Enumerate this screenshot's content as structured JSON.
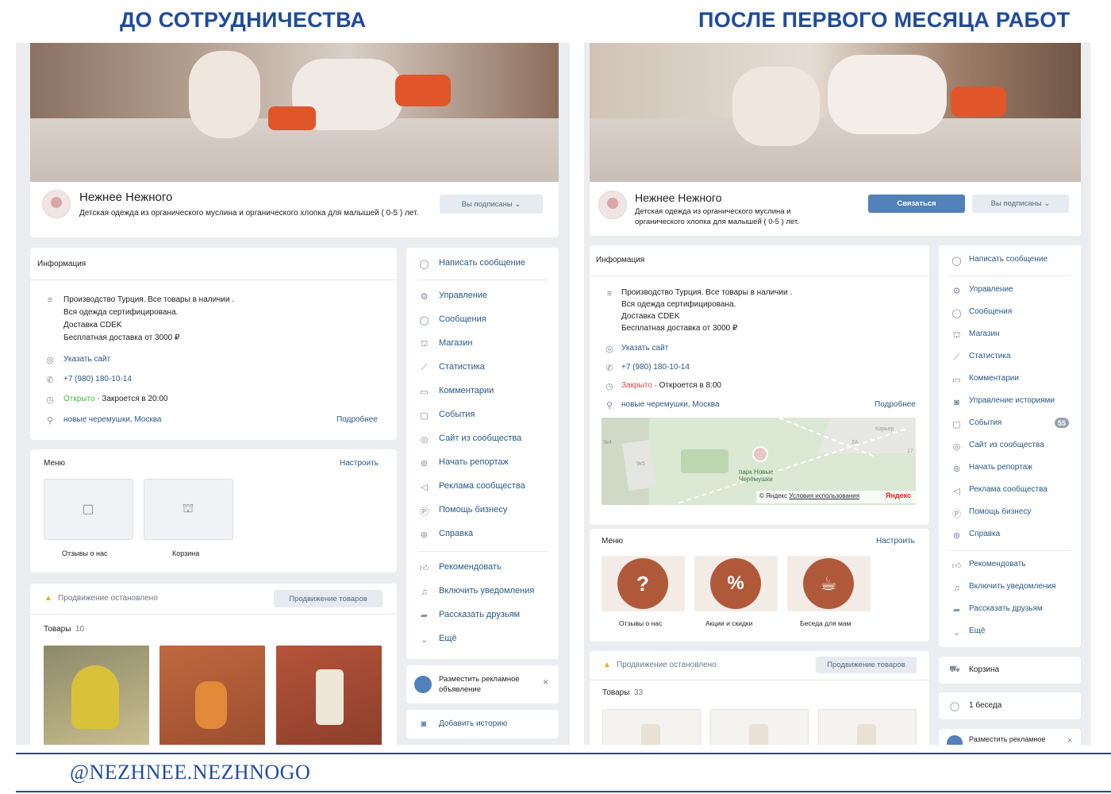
{
  "headings": {
    "before": "ДО СОТРУДНИЧЕСТВА",
    "after": "ПОСЛЕ ПЕРВОГО МЕСЯЦА РАБОТ"
  },
  "footer": "@NEZHNEE.NEZHNOGO",
  "colors": {
    "heading": "#1f4b9c",
    "vk_link": "#2a5885",
    "vk_primary": "#5181b8",
    "vk_bg": "#ebedf0"
  },
  "before": {
    "group_name": "Нежнее Нежного",
    "group_desc": "Детская одежда из органического муслина и органического хлопка для малышей ( 0-5 ) лет.",
    "subscribed_btn": "Вы подписаны",
    "info": {
      "title": "Информация",
      "desc_lines": [
        "Производство Турция. Все товары в наличии .",
        "Вся одежда сертифицирована.",
        "Доставка CDEK",
        "Бесплатная доставка от 3000 ₽"
      ],
      "site": "Указать сайт",
      "phone": "+7 (980) 180-10-14",
      "status": "Открыто",
      "status_detail": " · Закроется в 20:00",
      "address": "новые черемушки, Москва",
      "more": "Подробнее"
    },
    "menu": {
      "title": "Меню",
      "configure": "Настроить",
      "items": [
        "Отзывы о нас",
        "Корзина"
      ]
    },
    "promo": {
      "text": "Продвижение остановлено",
      "button": "Продвижение товаров"
    },
    "goods": {
      "title": "Товары",
      "count": "10"
    },
    "side_menu": {
      "write": "Написать сообщение",
      "items": [
        "Управление",
        "Сообщения",
        "Магазин",
        "Статистика",
        "Комментарии",
        "События",
        "Сайт из сообщества",
        "Начать репортаж",
        "Реклама сообщества",
        "Помощь бизнесу",
        "Справка"
      ],
      "items2": [
        "Рекомендовать",
        "Включить уведомления",
        "Рассказать друзьям",
        "Ещё"
      ],
      "ad": "Разместить рекламное объявление",
      "story": "Добавить историю"
    }
  },
  "after": {
    "group_name": "Нежнее Нежного",
    "group_desc_1": "Детская одежда из органического муслина и",
    "group_desc_2": "органического хлопка для малышей ( 0-5 ) лет.",
    "contact_btn": "Связаться",
    "subscribed_btn": "Вы подписаны",
    "info": {
      "title": "Информация",
      "desc_lines": [
        "Производство Турция. Все товары в наличии .",
        "Вся одежда сертифицирована.",
        "Доставка CDEK",
        "Бесплатная доставка от 3000 ₽"
      ],
      "site": "Указать сайт",
      "phone": "+7 (980) 180-10-14",
      "status": "Закрыто",
      "status_detail": " · Откроется в 8:00",
      "address": "новые черемушки, Москва",
      "more": "Подробнее"
    },
    "map": {
      "park": "парк Новые Черёмушки",
      "copyright": "© Яндекс",
      "terms": "Условия использования",
      "brand": "Яндекс",
      "tag1": "Карьер",
      "tag2": "9к4",
      "tag3": "9к5",
      "tag4": "2А",
      "tag5": "17"
    },
    "menu": {
      "title": "Меню",
      "configure": "Настроить",
      "items": [
        "Отзывы о нас",
        "Акции и скидки",
        "Беседа для мам"
      ]
    },
    "promo": {
      "text": "Продвижение остановлено",
      "button": "Продвижение товаров"
    },
    "goods": {
      "title": "Товары",
      "count": "33"
    },
    "side_menu": {
      "write": "Написать сообщение",
      "items": [
        "Управление",
        "Сообщения",
        "Магазин",
        "Статистика",
        "Комментарии",
        "Управление историями",
        "События",
        "Сайт из сообщества",
        "Начать репортаж",
        "Реклама сообщества",
        "Помощь бизнесу",
        "Справка"
      ],
      "events_badge": "55",
      "items2": [
        "Рекомендовать",
        "Включить уведомления",
        "Рассказать друзьям",
        "Ещё"
      ],
      "cart": "Корзина",
      "chat": "1 беседа",
      "ad": "Разместить рекламное"
    }
  }
}
